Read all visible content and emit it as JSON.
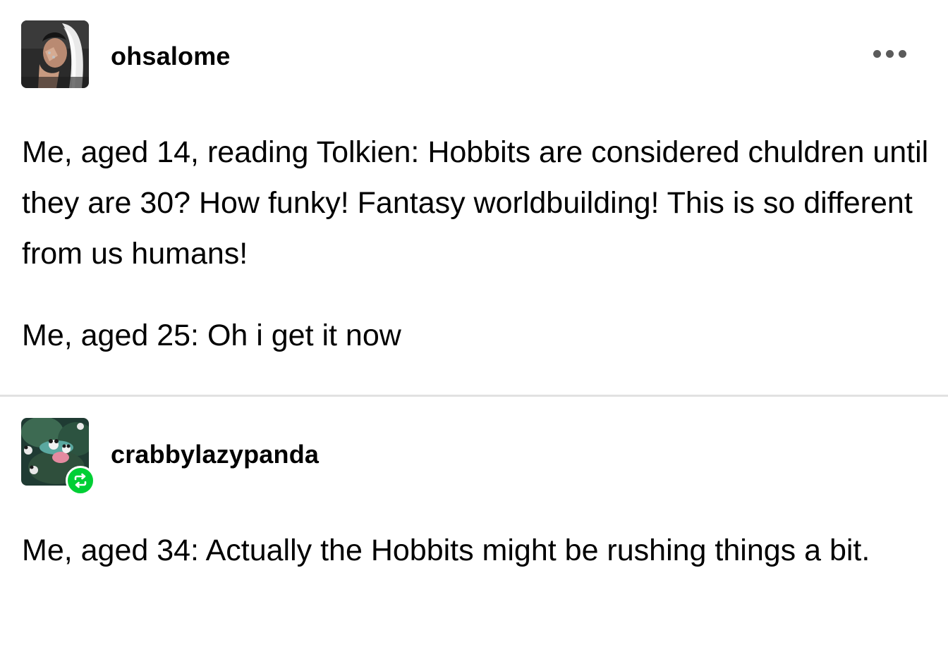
{
  "posts": [
    {
      "username": "ohsalome",
      "avatar_icon": "user-photo-avatar",
      "more_icon": "more-options-icon",
      "paragraphs": [
        "Me, aged 14, reading Tolkien: Hobbits are considered chuldren until they are 30? How funky! Fantasy worldbuilding! This is so different from us humans!",
        "Me, aged 25: Oh i get it now"
      ]
    },
    {
      "username": "crabbylazypanda",
      "avatar_icon": "panda-painting-avatar",
      "badge_icon": "reblog-icon",
      "paragraphs": [
        "Me, aged 34: Actually the Hobbits might be rushing things a bit."
      ]
    }
  ],
  "colors": {
    "reblog_badge": "#00cf35",
    "divider": "#e1e1e1",
    "more_dots": "#5b5b5b",
    "text": "#000000"
  }
}
